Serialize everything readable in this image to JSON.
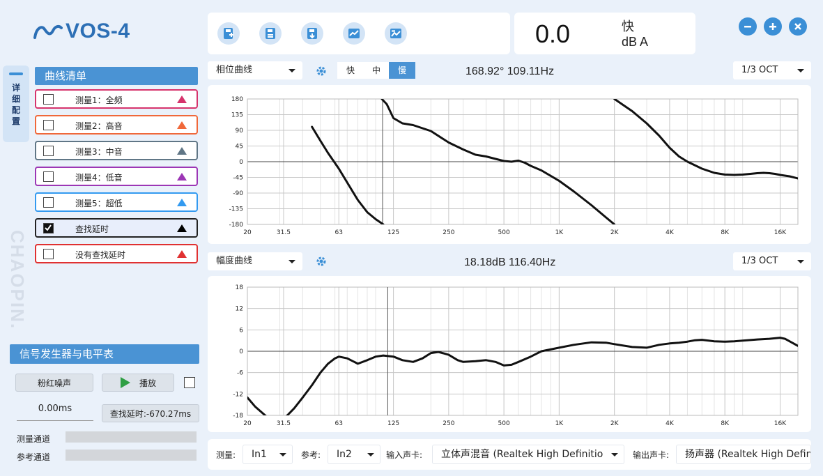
{
  "app": {
    "logo_text": "VOS-4"
  },
  "toolbar": {
    "icons": [
      "new-file-icon",
      "save-file-icon",
      "export-file-icon",
      "curve-chart-icon",
      "image-chart-icon"
    ]
  },
  "meter": {
    "value": "0.0",
    "mode": "快",
    "unit": "dB A"
  },
  "window_buttons": [
    "minus-icon",
    "plus-icon",
    "close-icon"
  ],
  "side_tab": {
    "label": "详细配置"
  },
  "watermark": "CHAOPIN.",
  "curve_list": {
    "title": "曲线清单",
    "items": [
      {
        "label": "测量1：全频",
        "color": "#d6336c",
        "checked": false
      },
      {
        "label": "测量2：高音",
        "color": "#f0683a",
        "checked": false
      },
      {
        "label": "测量3：中音",
        "color": "#607686",
        "checked": false
      },
      {
        "label": "测量4：低音",
        "color": "#9c36b5",
        "checked": false
      },
      {
        "label": "测量5：超低",
        "color": "#339af0",
        "checked": false
      },
      {
        "label": "查找延时",
        "color": "#000000",
        "checked": true
      },
      {
        "label": "没有查找延时",
        "color": "#e03131",
        "checked": false
      }
    ]
  },
  "signal": {
    "title": "信号发生器与电平表",
    "pink_noise": "粉红噪声",
    "play": "播放",
    "delay_value": "0.00ms",
    "find_delay": "查找延时:-670.27ms",
    "measure_channel": "测量通道",
    "reference_channel": "参考通道"
  },
  "phase_plot": {
    "type_select": "相位曲线",
    "speeds": [
      "快",
      "中",
      "慢"
    ],
    "active_speed": "慢",
    "readout": "168.92°  109.11Hz",
    "oct_select": "1/3 OCT"
  },
  "magnitude_plot": {
    "type_select": "幅度曲线",
    "readout": "18.18dB  116.40Hz",
    "oct_select": "1/3 OCT"
  },
  "bottom": {
    "measure_label": "测量:",
    "measure_value": "In1",
    "ref_label": "参考:",
    "ref_value": "In2",
    "input_label": "输入声卡:",
    "input_value": "立体声混音 (Realtek High Definitio",
    "output_label": "输出声卡:",
    "output_value": "扬声器 (Realtek High Definition"
  },
  "chart_data": [
    {
      "type": "line",
      "name": "phase",
      "x_ticks": [
        "20",
        "31.5",
        "63",
        "125",
        "250",
        "500",
        "1K",
        "2K",
        "4K",
        "8K",
        "16K"
      ],
      "y_ticks": [
        180,
        135,
        90,
        45,
        0,
        -45,
        -90,
        -135,
        -180
      ],
      "ylim": [
        -180,
        180
      ],
      "xlim": [
        20,
        20000
      ],
      "log_x": true,
      "cursor_hz": 109.11,
      "series": [
        {
          "x": [
            45,
            50,
            55,
            63,
            70,
            80,
            90,
            100,
            110
          ],
          "y": [
            100,
            60,
            25,
            -20,
            -60,
            -110,
            -145,
            -165,
            -180
          ]
        },
        {
          "x": [
            108,
            115,
            125,
            140,
            160,
            200,
            250,
            300,
            350,
            400,
            450,
            500,
            550,
            600,
            650,
            700,
            800,
            1000,
            1200,
            1500,
            1800,
            2000
          ],
          "y": [
            180,
            165,
            125,
            110,
            105,
            88,
            55,
            35,
            20,
            15,
            8,
            2,
            0,
            3,
            -3,
            -12,
            -25,
            -55,
            -85,
            -125,
            -160,
            -180
          ]
        },
        {
          "x": [
            2000,
            2500,
            3000,
            3500,
            4000,
            4500,
            5000,
            6000,
            7000,
            8000,
            9000,
            10000,
            11000,
            12000,
            13000,
            14000,
            15000,
            16000,
            18000,
            20000
          ],
          "y": [
            180,
            145,
            110,
            75,
            40,
            15,
            0,
            -20,
            -32,
            -37,
            -38,
            -37,
            -35,
            -33,
            -32,
            -33,
            -35,
            -38,
            -42,
            -48
          ]
        }
      ]
    },
    {
      "type": "line",
      "name": "magnitude",
      "x_ticks": [
        "20",
        "31.5",
        "63",
        "125",
        "250",
        "500",
        "1K",
        "2K",
        "4K",
        "8K",
        "16K"
      ],
      "y_ticks": [
        18,
        12,
        6,
        0,
        -6,
        -12,
        -18
      ],
      "ylim": [
        -18,
        18
      ],
      "xlim": [
        20,
        20000
      ],
      "log_x": true,
      "cursor_hz": 116.4,
      "series": [
        {
          "x": [
            20,
            22,
            25,
            28,
            30,
            33,
            36,
            40,
            45,
            50,
            55,
            60,
            63,
            70,
            80,
            90,
            100,
            110,
            125,
            140,
            160,
            180,
            200,
            220,
            250,
            280,
            300,
            350,
            400,
            450,
            500,
            550,
            600,
            700,
            800,
            1000,
            1200,
            1500,
            1800,
            2000,
            2500,
            3000,
            3500,
            4000,
            4500,
            5000,
            5500,
            6000,
            7000,
            8000,
            9000,
            10000,
            12000,
            14000,
            16000,
            17000,
            18000,
            20000
          ],
          "y": [
            -13,
            -15.5,
            -18,
            -20,
            -19.5,
            -18,
            -16,
            -13,
            -9.5,
            -6,
            -3.5,
            -2,
            -1.5,
            -2,
            -3.5,
            -2.5,
            -1.5,
            -1.2,
            -1.5,
            -2.5,
            -3,
            -2,
            -0.5,
            -0.2,
            -1,
            -2.5,
            -3,
            -2.8,
            -2.5,
            -3,
            -4,
            -3.8,
            -3,
            -1.5,
            0,
            1,
            1.8,
            2.5,
            2.4,
            2,
            1.2,
            1,
            1.8,
            2.2,
            2.4,
            2.7,
            3.1,
            3.2,
            2.8,
            2.7,
            2.8,
            3,
            3.3,
            3.5,
            3.8,
            3.5,
            2.8,
            1.5
          ]
        }
      ]
    }
  ]
}
